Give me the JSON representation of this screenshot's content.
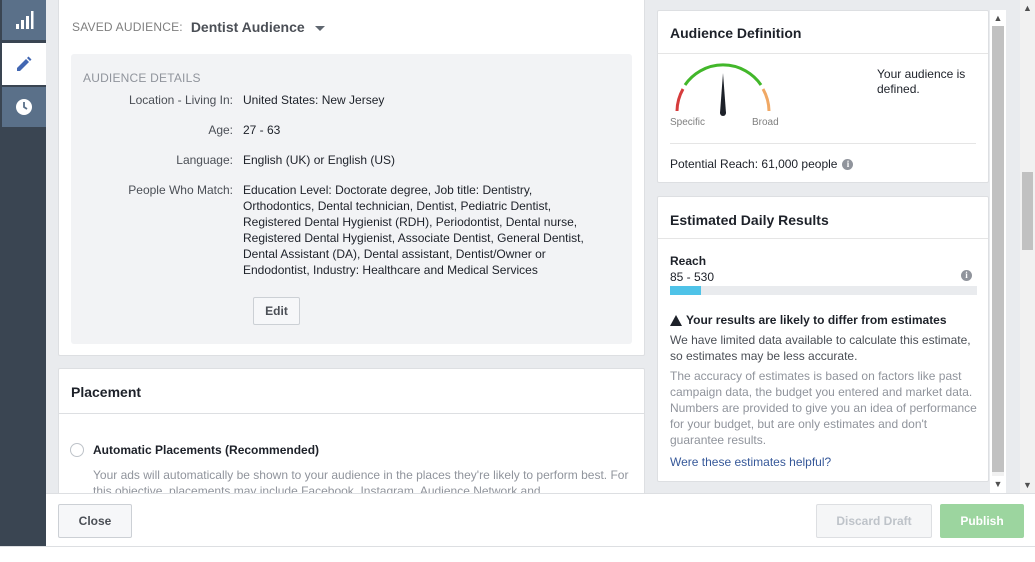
{
  "sidebar": {
    "items": [
      {
        "icon": "bar-chart-icon"
      },
      {
        "icon": "pencil-icon"
      },
      {
        "icon": "clock-icon"
      }
    ]
  },
  "audience": {
    "saved_label": "SAVED AUDIENCE:",
    "saved_value": "Dentist Audience",
    "details_title": "AUDIENCE DETAILS",
    "rows": [
      {
        "label": "Location - Living In:",
        "value": "United States: New Jersey"
      },
      {
        "label": "Age:",
        "value": "27 - 63"
      },
      {
        "label": "Language:",
        "value": "English (UK) or English (US)"
      },
      {
        "label": "People Who Match:",
        "value": "Education Level: Doctorate degree, Job title: Dentistry, Orthodontics, Dental technician, Dentist, Pediatric Dentist, Registered Dental Hygienist (RDH), Periodontist, Dental nurse, Registered Dental Hygienist, Associate Dentist, General Dentist, Dental Assistant (DA), Dental assistant, Dentist/Owner or Endodontist, Industry: Healthcare and Medical Services"
      }
    ],
    "edit_label": "Edit"
  },
  "placement": {
    "title": "Placement",
    "auto_label": "Automatic Placements (Recommended)",
    "auto_desc": "Your ads will automatically be shown to your audience in the places they're likely to perform best. For this objective, placements may include Facebook, Instagram, Audience Network and"
  },
  "definition": {
    "title": "Audience Definition",
    "gauge_specific": "Specific",
    "gauge_broad": "Broad",
    "status": "Your audience is defined.",
    "potential_reach": "Potential Reach: 61,000 people"
  },
  "estimates": {
    "title": "Estimated Daily Results",
    "reach_label": "Reach",
    "reach_range": "85 - 530",
    "reach_fill_fraction": 0.1,
    "warning_title": "Your results are likely to differ from estimates",
    "warning_text": "We have limited data available to calculate this estimate, so estimates may be less accurate.",
    "accuracy_text": "The accuracy of estimates is based on factors like past campaign data, the budget you entered and market data. Numbers are provided to give you an idea of performance for your budget, but are only estimates and don't guarantee results.",
    "helpful_link": "Were these estimates helpful?"
  },
  "footer": {
    "close_label": "Close",
    "discard_label": "Discard Draft",
    "publish_label": "Publish"
  },
  "colors": {
    "accent_link": "#365899",
    "publish_green": "#9cd59f",
    "reach_bar": "#4fc3e8",
    "gauge_red": "#d63c3c",
    "gauge_green": "#42b72a",
    "gauge_orange": "#f0a864"
  }
}
